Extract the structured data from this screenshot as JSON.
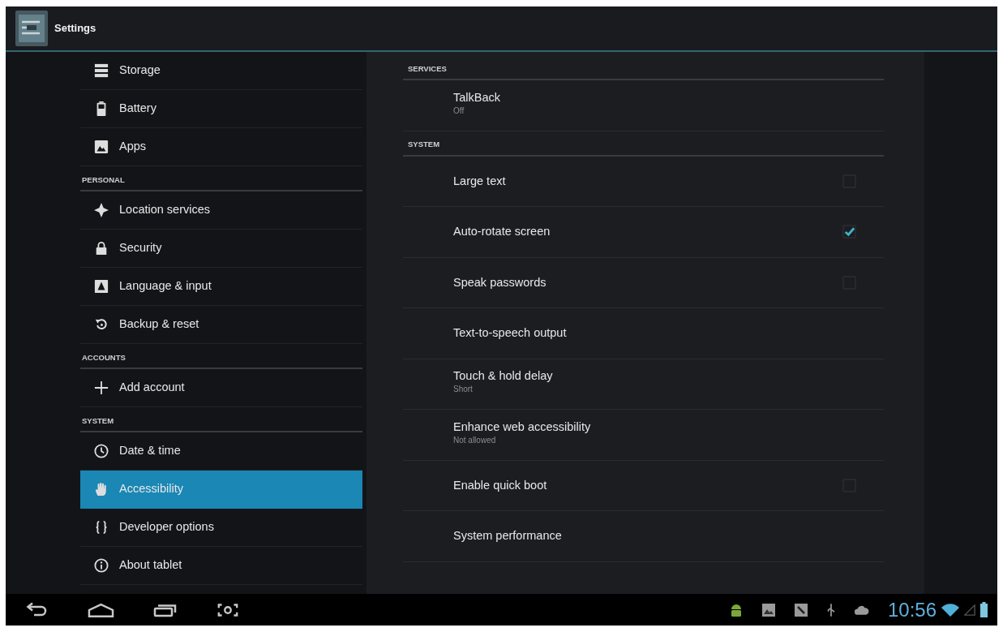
{
  "action_bar": {
    "title": "Settings"
  },
  "sidebar": {
    "sections": [
      {
        "items": [
          {
            "label": "Storage",
            "selected": false
          },
          {
            "label": "Battery",
            "selected": false
          },
          {
            "label": "Apps",
            "selected": false
          }
        ]
      },
      {
        "header": "PERSONAL",
        "items": [
          {
            "label": "Location services",
            "selected": false
          },
          {
            "label": "Security",
            "selected": false
          },
          {
            "label": "Language & input",
            "selected": false
          },
          {
            "label": "Backup & reset",
            "selected": false
          }
        ]
      },
      {
        "header": "ACCOUNTS",
        "items": [
          {
            "label": "Add account",
            "selected": false
          }
        ]
      },
      {
        "header": "SYSTEM",
        "items": [
          {
            "label": "Date & time",
            "selected": false
          },
          {
            "label": "Accessibility",
            "selected": true
          },
          {
            "label": "Developer options",
            "selected": false
          },
          {
            "label": "About tablet",
            "selected": false
          }
        ]
      }
    ]
  },
  "content": {
    "sections": [
      {
        "header": "SERVICES",
        "items": [
          {
            "kind": "text",
            "title": "TalkBack",
            "summary": "Off"
          }
        ]
      },
      {
        "header": "SYSTEM",
        "items": [
          {
            "kind": "checkbox",
            "title": "Large text",
            "checked": false
          },
          {
            "kind": "checkbox",
            "title": "Auto-rotate screen",
            "checked": true
          },
          {
            "kind": "checkbox",
            "title": "Speak passwords",
            "checked": false
          },
          {
            "kind": "text",
            "title": "Text-to-speech output"
          },
          {
            "kind": "text",
            "title": "Touch & hold delay",
            "summary": "Short"
          },
          {
            "kind": "text",
            "title": "Enhance web accessibility",
            "summary": "Not allowed"
          },
          {
            "kind": "checkbox",
            "title": "Enable quick boot",
            "checked": false
          },
          {
            "kind": "text",
            "title": "System performance"
          }
        ]
      }
    ]
  },
  "status_bar": {
    "time": "10:56"
  }
}
